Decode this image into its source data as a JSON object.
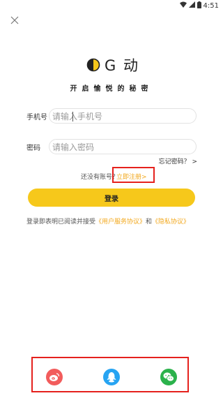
{
  "status_bar": {
    "time": "4:51"
  },
  "brand": {
    "logo_text": "G 动",
    "tagline": "开启愉悦的秘密"
  },
  "phone_field": {
    "label": "手机号",
    "placeholder": "请输入手机号"
  },
  "password_field": {
    "label": "密码",
    "placeholder": "请输入密码"
  },
  "forgot_link": "忘记密码？ >",
  "signup": {
    "hint": "还没有账号？",
    "link": "立即注册>"
  },
  "login_button": "登录",
  "agreement": {
    "prefix": "登录即表明已阅读并接受",
    "terms": "《用户服务协议》",
    "and": "和",
    "privacy": "《隐私协议》"
  },
  "social_logins": [
    {
      "icon": "weibo-icon",
      "color": "#f25c5c"
    },
    {
      "icon": "qq-icon",
      "color": "#27a4f2"
    },
    {
      "icon": "wechat-icon",
      "color": "#2bb24c"
    }
  ],
  "colors": {
    "accent": "#f6c81b",
    "link": "#f2a81d",
    "highlight_box": "#e5211d"
  }
}
